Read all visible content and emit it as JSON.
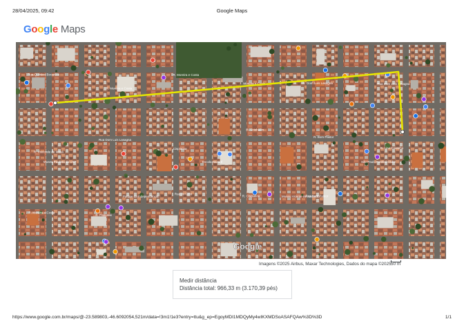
{
  "header": {
    "date": "28/04/2025, 09:42",
    "title": "Google Maps"
  },
  "logo": {
    "letters": [
      "G",
      "o",
      "o",
      "g",
      "l",
      "e"
    ],
    "suffix": "Maps"
  },
  "map": {
    "watermark": "Google",
    "route_color": "#e6e600",
    "street_labels": [
      "Rua Quintino Bocaiúva",
      "R. Moreira e Costa",
      "R. Moreira e Costa",
      "Moreira e Costa",
      "R. Dom Luís Lasagna",
      "Rua Dom Luís Lasagna",
      "R. Visconde de Mauá",
      "Rua Dom Luis Lasagna",
      "Cisplatina",
      "R. Sirinhaém",
      "R. Bom Pastor",
      "R. Lino Coutinho",
      "R. Moreira e Costa",
      "R. Patriotas",
      "Rua do Grito",
      "R. Cisplatina",
      "Rua Bom Pastor"
    ],
    "place_labels": [
      "Museu Paulista da USP",
      "Parque da Independência",
      "Escola Nazaré",
      "Museu Vicente de Azevedo",
      "São Paulo Futebol Clube"
    ]
  },
  "attribution": "Imagens ©2025 Airbus, Maxar Technologies, Dados do mapa ©2025",
  "scale": "50 m",
  "measure": {
    "title": "Medir distância",
    "total": "Distância total: 966,33 m (3.170,39 pés)"
  },
  "footer": {
    "url": "https://www.google.com.br/maps/@-23.589803,-46.6092054,521m/data=!3m1!1e3?entry=ttu&g_ep=EgoyMDI1MDQyMy4wIKXMDSoASAFQAw%3D%3D",
    "page": "1/1"
  }
}
